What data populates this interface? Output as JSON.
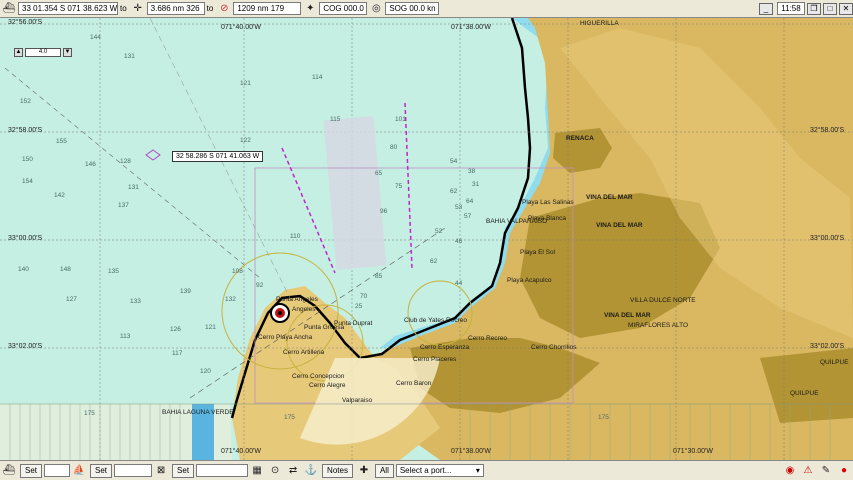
{
  "toolbar": {
    "position": "33 01.354 S   071 38.623 W",
    "range": "3.686 nm   326",
    "to_label": "to",
    "bearing": "1209 nm   179",
    "cog": "COG 000.0",
    "sog": "SOG 00.0 kn",
    "clock": "11:58"
  },
  "zoom": {
    "value": "4.0"
  },
  "cursor_readout": "32 58.286 S   071 41.063 W",
  "grid_labels": {
    "lat_top_left": "32°56.00'S",
    "lat_5800_left": "32°58.00'S",
    "lat_0000_left": "33°00.00'S",
    "lat_0200_left": "33°02.00'S",
    "lat_5800_right": "32°58.00'S",
    "lat_0000_right": "33°00.00'S",
    "lat_0200_right": "33°02.00'S",
    "lon_4000_top": "071°40.00'W",
    "lon_3800_top": "071°38.00'W",
    "lon_4000_bottom": "071°40.00'W",
    "lon_3800_bottom": "071°38.00'W",
    "lon_3000_bottom": "071°30.00'W"
  },
  "places": {
    "renaca": "RENACA",
    "vina_del_mar_1": "VINA DEL MAR",
    "vina_del_mar_2": "VINA DEL MAR",
    "vina_del_mar_3": "VINA DEL MAR",
    "bahia_valparaiso": "BAHIA VALPARAISO",
    "playa_las_salinas": "Playa Las Salinas",
    "playa_blanca": "Playa Blanca",
    "playa_el_sol": "Playa El Sol",
    "playa_acapulco": "Playa Acapulco",
    "punta_angeles": "Punta Angeles",
    "angeles": "Angeles",
    "cerro_playa_ancha": "Cerro Playa Ancha",
    "punta_duprat": "Punta Duprat",
    "punta_gruesa": "Punta Gruesa",
    "cerro_artilleria": "Cerro Artilleria",
    "cerro_esperanza": "Cerro Esperanza",
    "cerro_recreo": "Cerro Recreo",
    "cerro_chorrillos": "Cerro Chorrillos",
    "cerro_placeres": "Cerro Placeres",
    "cerro_concepcion": "Cerro Concepcion",
    "cerro_alegre": "Cerro Alegre",
    "cerro_baron": "Cerro Baron",
    "villa_dulce_norte": "VILLA DULCE NORTE",
    "miraflores_alto": "MIRAFLORES ALTO",
    "quilpue_1": "QUILPUE",
    "quilpue_2": "QUILPUE",
    "bahia_laguna_verde": "BAHIA LAGUNA VERDE",
    "valparaiso": "Valparaiso",
    "higuerilla": "HIGUERILLA",
    "club_de_yates": "Club de Yates Recreo"
  },
  "soundings": [
    "144",
    "131",
    "152",
    "155",
    "121",
    "114",
    "115",
    "80",
    "101",
    "146",
    "128",
    "122",
    "75",
    "54",
    "38",
    "31",
    "154",
    "142",
    "131",
    "137",
    "96",
    "110",
    "52",
    "64",
    "148",
    "135",
    "127",
    "140",
    "150",
    "92",
    "62",
    "46",
    "57",
    "133",
    "139",
    "126",
    "121",
    "120",
    "85",
    "70",
    "25",
    "44",
    "113",
    "117",
    "132",
    "108",
    "62",
    "65",
    "53",
    "175",
    "175",
    "175"
  ],
  "bottombar": {
    "set1": "Set",
    "set2": "Set",
    "set3": "Set",
    "notes": "Notes",
    "all": "All",
    "port_select": "Select a port..."
  },
  "colors": {
    "sea_deep": "#c4efe2",
    "sea_shallow": "#8fdcef",
    "land": "#d9b861",
    "land_dark": "#a8891e",
    "urban": "#b29434",
    "sand": "#e7c97a",
    "route_magenta": "#c026c8",
    "coast": "#000000"
  }
}
